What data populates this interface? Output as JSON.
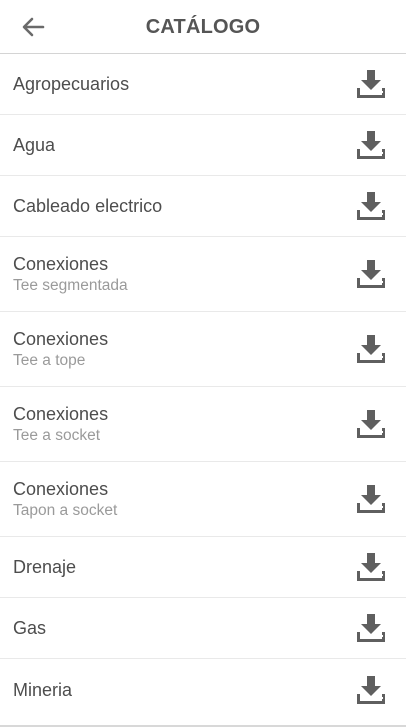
{
  "header": {
    "title": "CATÁLOGO",
    "back_icon": "arrow-left-icon"
  },
  "catalog": {
    "download_icon": "download-icon",
    "items": [
      {
        "title": "Agropecuarios",
        "subtitle": ""
      },
      {
        "title": "Agua",
        "subtitle": ""
      },
      {
        "title": "Cableado electrico",
        "subtitle": ""
      },
      {
        "title": "Conexiones",
        "subtitle": "Tee segmentada"
      },
      {
        "title": "Conexiones",
        "subtitle": "Tee a tope"
      },
      {
        "title": "Conexiones",
        "subtitle": "Tee a socket"
      },
      {
        "title": "Conexiones",
        "subtitle": "Tapon a socket"
      },
      {
        "title": "Drenaje",
        "subtitle": ""
      },
      {
        "title": "Gas",
        "subtitle": ""
      },
      {
        "title": "Mineria",
        "subtitle": ""
      }
    ]
  },
  "colors": {
    "title": "#555555",
    "item_text": "#4d4d4d",
    "subtitle_text": "#9a9a9a",
    "icon": "#5f5f5f",
    "divider": "#e9e9e9"
  }
}
